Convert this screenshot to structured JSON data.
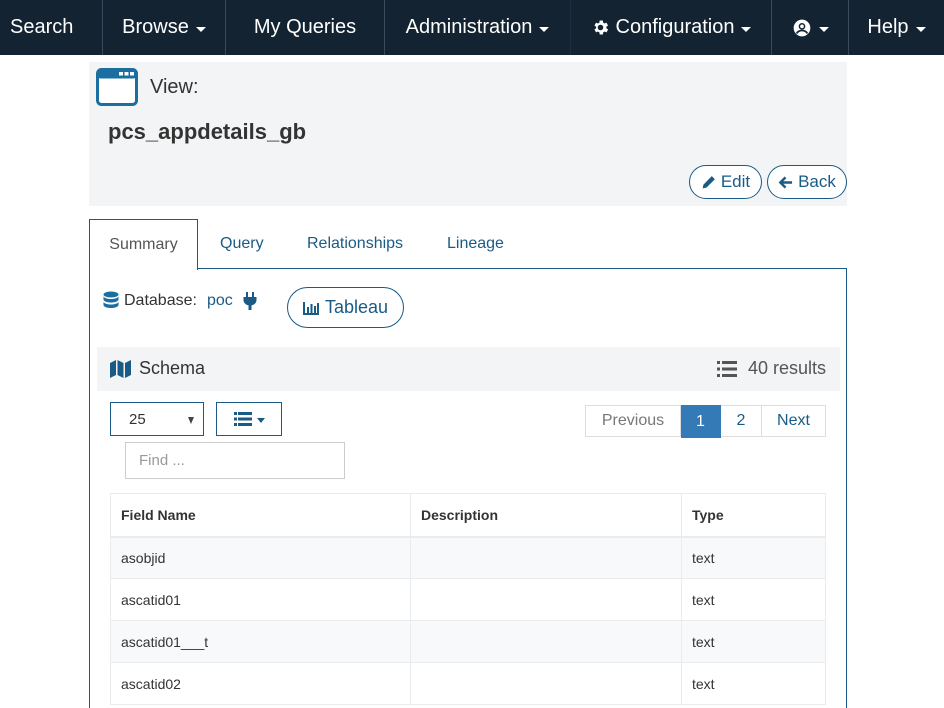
{
  "nav": {
    "search": "Search",
    "browse": "Browse",
    "my_queries": "My Queries",
    "administration": "Administration",
    "configuration": "Configuration",
    "help": "Help"
  },
  "header": {
    "type_label": "View:",
    "name": "pcs_appdetails_gb",
    "edit_label": "Edit",
    "back_label": "Back"
  },
  "tabs": [
    {
      "label": "Summary",
      "active": true
    },
    {
      "label": "Query"
    },
    {
      "label": "Relationships"
    },
    {
      "label": "Lineage"
    }
  ],
  "summary": {
    "database_label": "Database:",
    "database_value": "poc",
    "tableau_label": "Tableau"
  },
  "schema": {
    "title": "Schema",
    "results": "40 results",
    "page_size": "25",
    "find_placeholder": "Find ...",
    "pager": {
      "previous": "Previous",
      "pages": [
        "1",
        "2"
      ],
      "current": "1",
      "next": "Next"
    },
    "columns": [
      "Field Name",
      "Description",
      "Type"
    ],
    "rows": [
      {
        "field": "asobjid",
        "description": "",
        "type": "text"
      },
      {
        "field": "ascatid01",
        "description": "",
        "type": "text"
      },
      {
        "field": "ascatid01___t",
        "description": "",
        "type": "text"
      },
      {
        "field": "ascatid02",
        "description": "",
        "type": "text"
      }
    ]
  },
  "colors": {
    "nav_bg": "#132332",
    "accent": "#1a5b86",
    "active_page": "#337ab7",
    "panel_bg": "#f3f4f6"
  }
}
